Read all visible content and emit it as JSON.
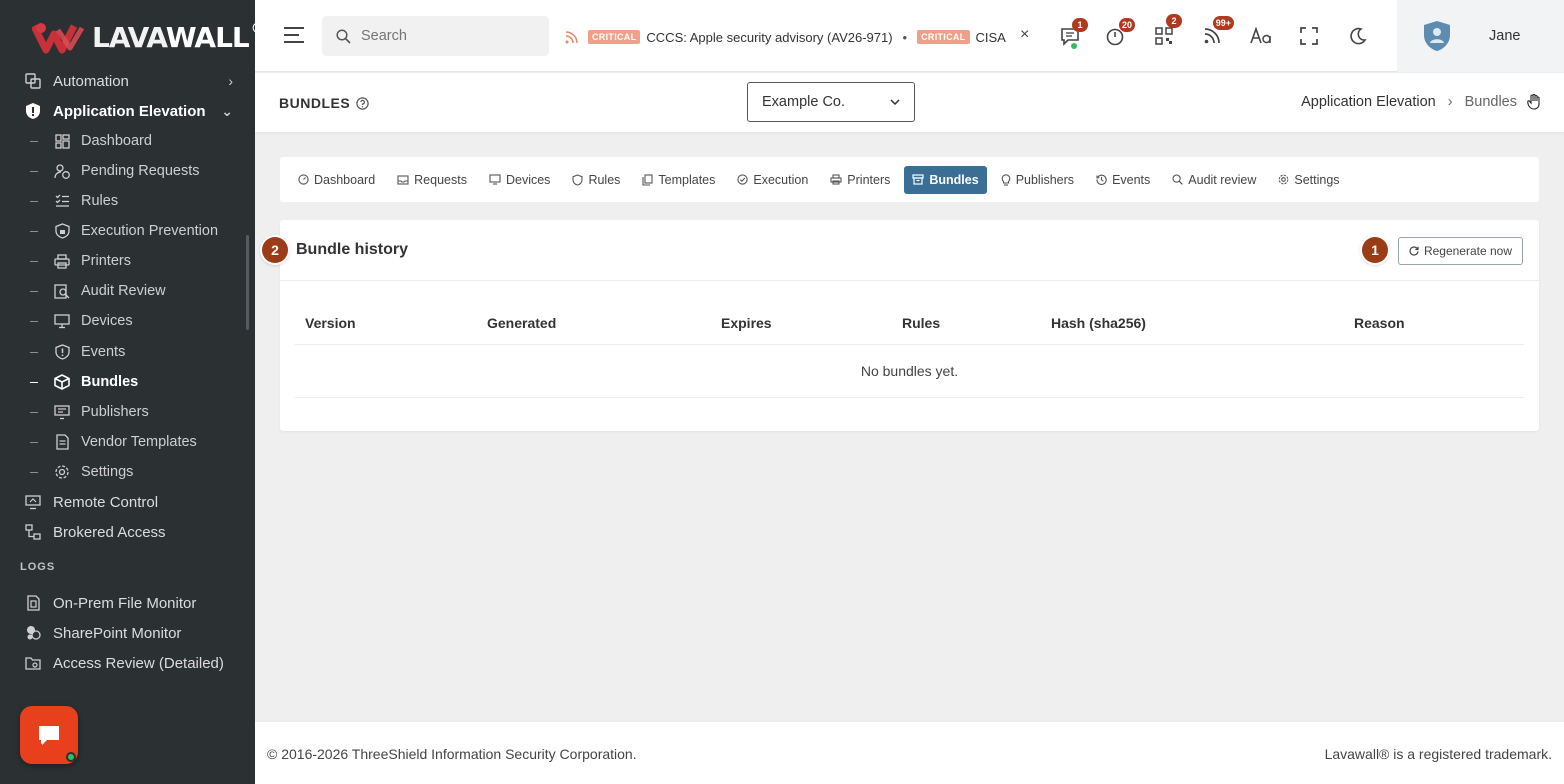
{
  "brand": {
    "name_a": "LAVA",
    "name_b": "WALL",
    "reg": "®"
  },
  "sidebar": {
    "top_items": [
      {
        "label": "Automation",
        "icon": "automation-icon"
      },
      {
        "label": "Application Elevation",
        "icon": "shield-icon"
      }
    ],
    "sub_items": [
      {
        "label": "Dashboard"
      },
      {
        "label": "Pending Requests"
      },
      {
        "label": "Rules"
      },
      {
        "label": "Execution Prevention"
      },
      {
        "label": "Printers"
      },
      {
        "label": "Audit Review"
      },
      {
        "label": "Devices"
      },
      {
        "label": "Events"
      },
      {
        "label": "Bundles"
      },
      {
        "label": "Publishers"
      },
      {
        "label": "Vendor Templates"
      },
      {
        "label": "Settings"
      }
    ],
    "lower_items": [
      {
        "label": "Remote Control"
      },
      {
        "label": "Brokered Access"
      }
    ],
    "logs_label": "LOGS",
    "log_items": [
      {
        "label": "On-Prem File Monitor"
      },
      {
        "label": "SharePoint Monitor"
      },
      {
        "label": "Access Review (Detailed)"
      }
    ]
  },
  "topbar": {
    "search_placeholder": "Search",
    "ticker": [
      {
        "badge": "CRITICAL",
        "text": "CCCS: Apple security advisory (AV26-971)"
      },
      {
        "badge": "CRITICAL",
        "text": "CISA"
      }
    ],
    "ticker_sep": "•",
    "close_glyph": "×",
    "badges": {
      "messages": "1",
      "timer": "20",
      "qr": "2",
      "feed": "99+"
    },
    "user_name": "Jane"
  },
  "page": {
    "title": "BUNDLES",
    "org": "Example Co.",
    "breadcrumb": [
      "Application Elevation",
      "Bundles"
    ]
  },
  "tabs": [
    {
      "label": "Dashboard"
    },
    {
      "label": "Requests"
    },
    {
      "label": "Devices"
    },
    {
      "label": "Rules"
    },
    {
      "label": "Templates"
    },
    {
      "label": "Execution"
    },
    {
      "label": "Printers"
    },
    {
      "label": "Bundles"
    },
    {
      "label": "Publishers"
    },
    {
      "label": "Events"
    },
    {
      "label": "Audit review"
    },
    {
      "label": "Settings"
    }
  ],
  "card": {
    "title": "Bundle history",
    "regen_label": "Regenerate now",
    "step_title": "2",
    "step_regen": "1",
    "columns": [
      "Version",
      "Generated",
      "Expires",
      "Rules",
      "Hash (sha256)",
      "Reason"
    ],
    "empty": "No bundles yet."
  },
  "footer": {
    "copyright": "© 2016-2026 ThreeShield Information Security Corporation.",
    "trademark": "Lavawall® is a registered trademark."
  },
  "colors": {
    "sidebar": "#2b3033",
    "accent": "#3a6e94",
    "step": "#9b3b17",
    "chat": "#e8401c"
  }
}
